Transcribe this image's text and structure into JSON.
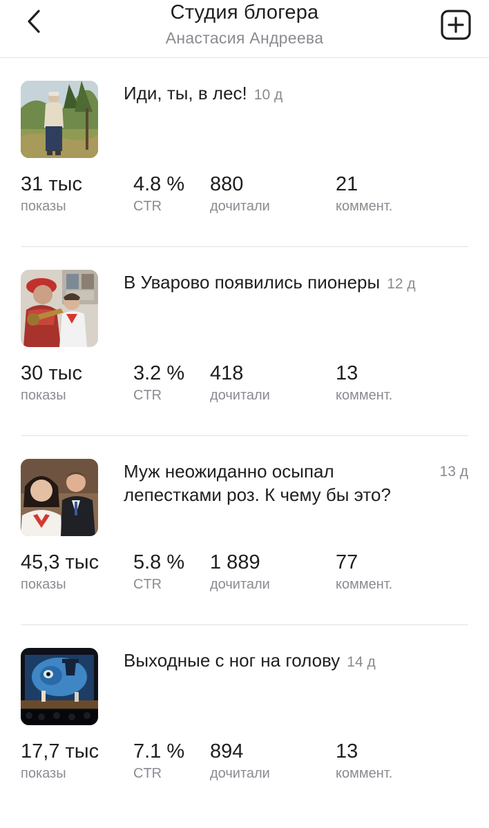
{
  "header": {
    "title": "Студия блогера",
    "subtitle": "Анастасия Андреева",
    "back_icon": "chevron-left-icon",
    "add_icon": "plus-square-icon"
  },
  "labels": {
    "impressions": "показы",
    "ctr": "CTR",
    "read": "дочитали",
    "comments": "коммент."
  },
  "posts": [
    {
      "title": "Иди, ты, в лес!",
      "age": "10 д",
      "impressions": "31 тыс",
      "ctr": "4.8 %",
      "read": "880",
      "comments": "21",
      "thumb": "woman-in-forest-photo"
    },
    {
      "title": "В Уварово появились пионеры",
      "age": "12 д",
      "impressions": "30 тыс",
      "ctr": "3.2 %",
      "read": "418",
      "comments": "13",
      "thumb": "pioneers-with-bugle-photo"
    },
    {
      "title": "Муж неожиданно осыпал лепестками роз. К чему бы это?",
      "age": "13 д",
      "impressions": "45,3 тыс",
      "ctr": "5.8 %",
      "read": "1 889",
      "comments": "77",
      "thumb": "couple-portrait-photo"
    },
    {
      "title": "Выходные с ног на голову",
      "age": "14 д",
      "impressions": "17,7 тыс",
      "ctr": "7.1 %",
      "read": "894",
      "comments": "13",
      "thumb": "theater-stage-photo"
    }
  ]
}
